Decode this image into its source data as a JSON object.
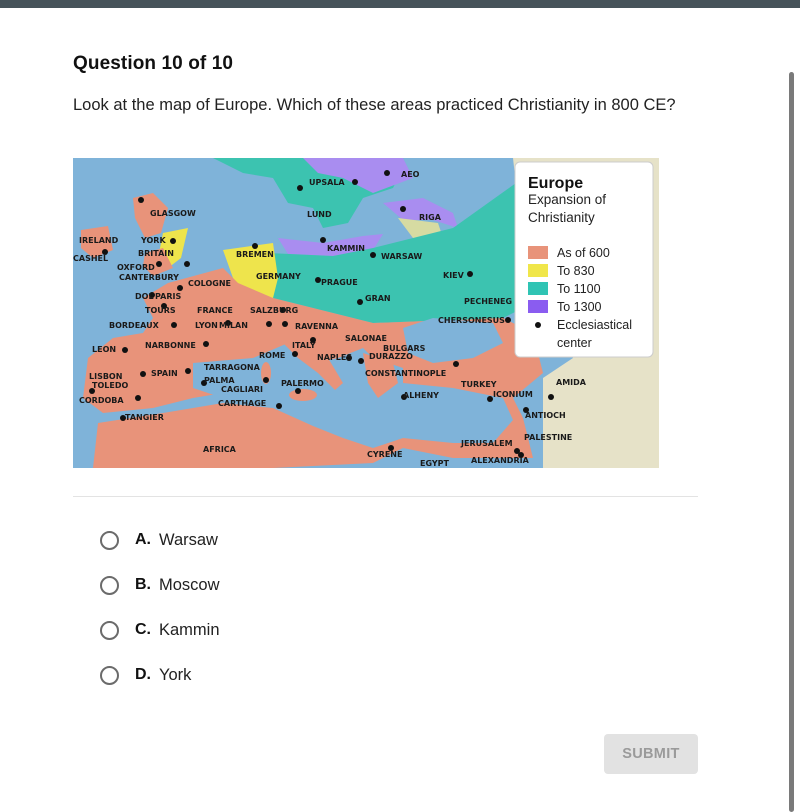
{
  "page": {
    "question_title": "Question 10 of 10",
    "question_text": "Look at the map of Europe. Which of these areas practiced Christianity in 800 CE?"
  },
  "map": {
    "legend": {
      "title": "Europe",
      "subtitle_line1": "Expansion of",
      "subtitle_line2": "Christianity",
      "items": [
        {
          "label": "As of 600",
          "color": "#e8937a"
        },
        {
          "label": "To 830",
          "color": "#f0e64a"
        },
        {
          "label": "To 1100",
          "color": "#2fc4b4"
        },
        {
          "label": "To 1300",
          "color": "#8a5cf0"
        }
      ],
      "center_label_line1": "Ecclesiastical",
      "center_label_line2": "center"
    },
    "colors": {
      "sea": "#7fb3d9",
      "land_600": "#e8937a",
      "land_830": "#eee44c",
      "land_1100": "#3cc3b0",
      "land_1300": "#a98df0",
      "land_other": "#e6e2c8"
    },
    "labels": [
      "GLASGOW",
      "IRELAND",
      "CASHEL",
      "YORK",
      "BRITAIN",
      "OXFORD",
      "CANTERBURY",
      "COLOGNE",
      "BREMEN",
      "GERMANY",
      "DOL",
      "PARIS",
      "TOURS",
      "FRANCE",
      "SALZBURG",
      "BORDEAUX",
      "LYON",
      "MILAN",
      "LEON",
      "NARBONNE",
      "RAVENNA",
      "ITALY",
      "ROME",
      "NAPLES",
      "TARRAGONA",
      "SPAIN",
      "LISBON",
      "TOLEDO",
      "CORDOBA",
      "PALMA",
      "CAGLIARI",
      "PALERMO",
      "CARTHAGE",
      "TANGIER",
      "AFRICA",
      "UPSALA",
      "AEO",
      "LUND",
      "RIGA",
      "KAMMIN",
      "WARSAW",
      "KIEV",
      "PRAGUE",
      "GRAN",
      "PECHENEG",
      "CHERSONESUS",
      "SALONAE",
      "BULGARS",
      "DURAZZO",
      "CONSTANTINOPLE",
      "ALHENY",
      "TURKEY",
      "ICONIUM",
      "AMIDA",
      "ANTIOCH",
      "PALESTINE",
      "JERUSALEM",
      "ALEXANDRIA",
      "CYRENE",
      "EGYPT"
    ]
  },
  "options": [
    {
      "letter": "A.",
      "label": "Warsaw"
    },
    {
      "letter": "B.",
      "label": "Moscow"
    },
    {
      "letter": "C.",
      "label": "Kammin"
    },
    {
      "letter": "D.",
      "label": "York"
    }
  ],
  "submit_label": "SUBMIT"
}
